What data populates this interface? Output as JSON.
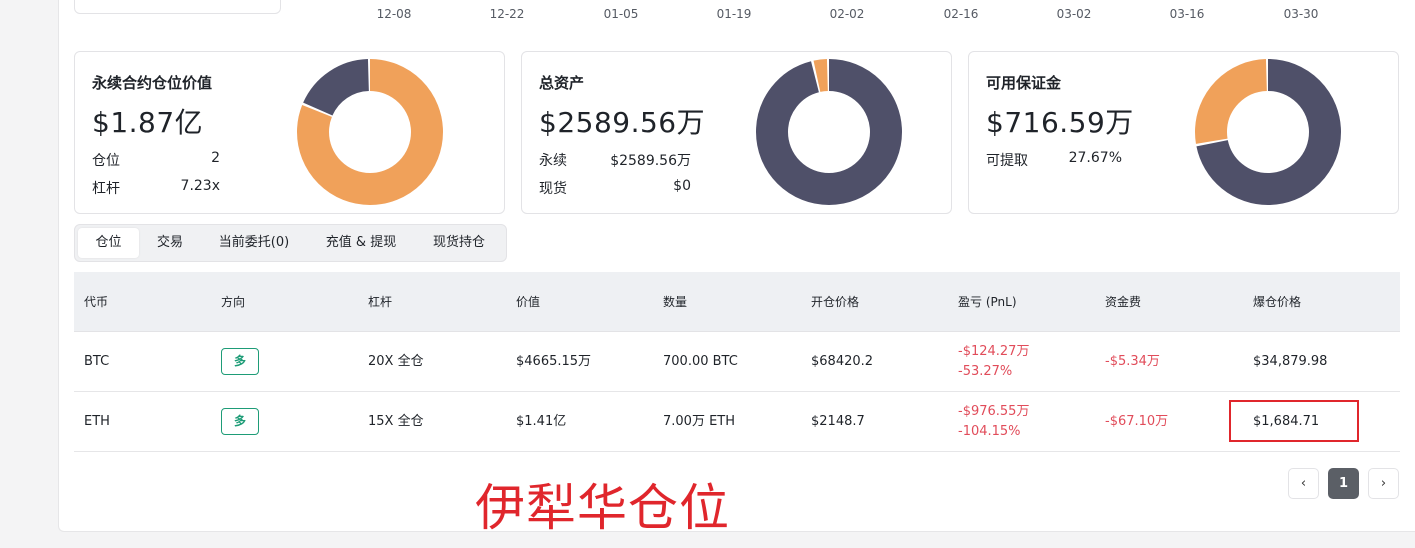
{
  "date_axis": [
    "12-08",
    "12-22",
    "01-05",
    "01-19",
    "02-02",
    "02-16",
    "03-02",
    "03-16",
    "03-30"
  ],
  "colors": {
    "orange": "#f0a15a",
    "navy": "#4f5069",
    "green": "#1e9c77",
    "red": "#e14c5a",
    "highlight": "#e0262c"
  },
  "cards": [
    {
      "title": "永续合约仓位价值",
      "value": "$1.87亿",
      "stats": [
        {
          "label": "仓位",
          "value": "2"
        },
        {
          "label": "杠杆",
          "value": "7.23x"
        }
      ],
      "donut": [
        {
          "name": "orange",
          "fraction": 0.815
        },
        {
          "name": "navy",
          "fraction": 0.185
        }
      ]
    },
    {
      "title": "总资产",
      "value": "$2589.56万",
      "stats": [
        {
          "label": "永续",
          "value": "$2589.56万"
        },
        {
          "label": "现货",
          "value": "$0"
        }
      ],
      "donut": [
        {
          "name": "navy",
          "fraction": 0.965
        },
        {
          "name": "orange",
          "fraction": 0.035
        }
      ]
    },
    {
      "title": "可用保证金",
      "value": "$716.59万",
      "stats": [
        {
          "label": "可提取",
          "value": "27.67%"
        }
      ],
      "donut": [
        {
          "name": "navy",
          "fraction": 0.7233
        },
        {
          "name": "orange",
          "fraction": 0.2767
        }
      ]
    }
  ],
  "tabs": [
    "仓位",
    "交易",
    "当前委托(0)",
    "充值 & 提现",
    "现货持仓"
  ],
  "active_tab": 0,
  "table": {
    "headers": [
      "代币",
      "方向",
      "杠杆",
      "价值",
      "数量",
      "开仓价格",
      "盈亏 (PnL)",
      "资金费",
      "爆仓价格"
    ],
    "rows": [
      {
        "token": "BTC",
        "side": "多",
        "leverage": "20X 全仓",
        "value": "$4665.15万",
        "quantity": "700.00 BTC",
        "entry": "$68420.2",
        "pnl": "-$124.27万",
        "pnl_pct": "-53.27%",
        "funding": "-$5.34万",
        "liq": "$34,879.98"
      },
      {
        "token": "ETH",
        "side": "多",
        "leverage": "15X 全仓",
        "value": "$1.41亿",
        "quantity": "7.00万 ETH",
        "entry": "$2148.7",
        "pnl": "-$976.55万",
        "pnl_pct": "-104.15%",
        "funding": "-$67.10万",
        "liq": "$1,684.71"
      }
    ]
  },
  "pagination": {
    "prev": "‹",
    "current": "1",
    "next": "›"
  },
  "annotation": "伊犁华仓位"
}
